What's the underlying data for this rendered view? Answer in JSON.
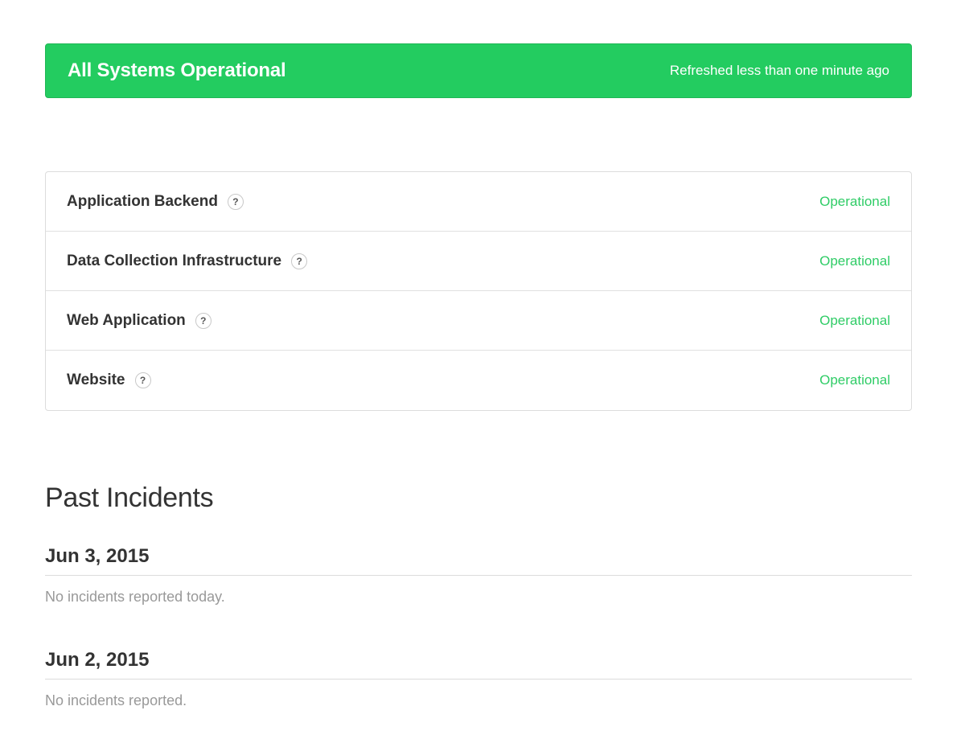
{
  "banner": {
    "title": "All Systems Operational",
    "refreshed": "Refreshed less than one minute ago",
    "color": "#23cc60"
  },
  "components": [
    {
      "name": "Application Backend",
      "help": "?",
      "status": "Operational"
    },
    {
      "name": "Data Collection Infrastructure",
      "help": "?",
      "status": "Operational"
    },
    {
      "name": "Web Application",
      "help": "?",
      "status": "Operational"
    },
    {
      "name": "Website",
      "help": "?",
      "status": "Operational"
    }
  ],
  "status_color": "#2fcc66",
  "past_incidents": {
    "title": "Past Incidents",
    "days": [
      {
        "date": "Jun 3, 2015",
        "text": "No incidents reported today."
      },
      {
        "date": "Jun 2, 2015",
        "text": "No incidents reported."
      }
    ]
  }
}
